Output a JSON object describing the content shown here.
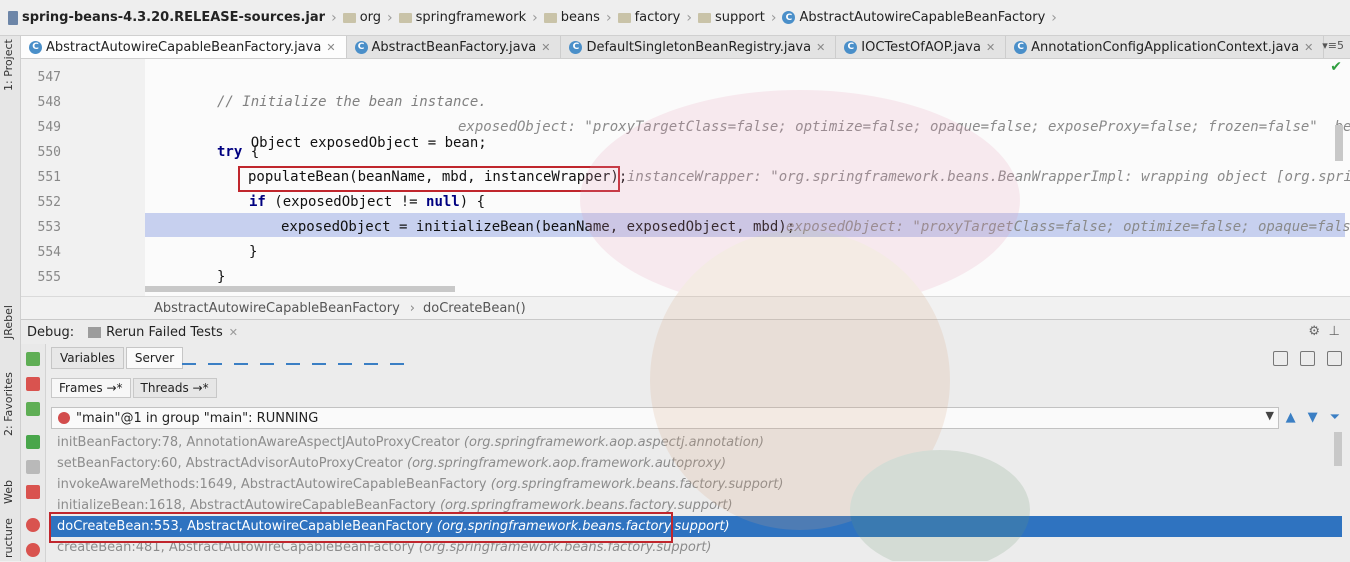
{
  "breadcrumb": [
    {
      "label": "spring-beans-4.3.20.RELEASE-sources.jar",
      "icon": "jar-icon"
    },
    {
      "label": "org",
      "icon": "folder-icon"
    },
    {
      "label": "springframework",
      "icon": "folder-icon"
    },
    {
      "label": "beans",
      "icon": "folder-icon"
    },
    {
      "label": "factory",
      "icon": "folder-icon"
    },
    {
      "label": "support",
      "icon": "folder-icon"
    },
    {
      "label": "AbstractAutowireCapableBeanFactory",
      "icon": "class-icon"
    }
  ],
  "side_tabs": {
    "project": "1: Project",
    "jrebel": "JRebel",
    "favorites": "2: Favorites",
    "web": "Web",
    "structure": "ructure"
  },
  "editor_tabs": [
    {
      "label": "AbstractAutowireCapableBeanFactory.java",
      "active": true
    },
    {
      "label": "AbstractBeanFactory.java",
      "active": false
    },
    {
      "label": "DefaultSingletonBeanRegistry.java",
      "active": false
    },
    {
      "label": "IOCTestOfAOP.java",
      "active": false
    },
    {
      "label": "AnnotationConfigApplicationContext.java",
      "active": false
    }
  ],
  "tab_menu": "5",
  "code": {
    "lines": [
      "547",
      "548",
      "549",
      "550",
      "551",
      "552",
      "553",
      "554",
      "555"
    ],
    "l548": "// Initialize the bean instance.",
    "l549_code": "Object exposedObject = bean;",
    "l549_hint": "exposedObject: \"proxyTargetClass=false; optimize=false; opaque=false; exposeProxy=false; frozen=false\"  bean: \"",
    "l550_kw": "try",
    "l550_rest": " {",
    "l551_code": "populateBean(beanName, mbd, instanceWrapper);",
    "l551_hint": "instanceWrapper: \"org.springframework.beans.BeanWrapperImpl: wrapping object [org.springfra",
    "l552_kw": "if",
    "l552_mid": " (exposedObject != ",
    "l552_kw2": "null",
    "l552_end": ") {",
    "l553_code": "exposedObject = initializeBean(beanName, exposedObject, mbd);",
    "l553_hint": "exposedObject: \"proxyTargetClass=false; optimize=false; opaque=false;",
    "l554": "}",
    "l555": "}"
  },
  "code_crumb": {
    "class": "AbstractAutowireCapableBeanFactory",
    "method": "doCreateBean()"
  },
  "debug": {
    "title": "Debug:",
    "rerun_tab": "Rerun Failed Tests",
    "tabs": [
      {
        "label": "Variables",
        "active": false
      },
      {
        "label": "Server",
        "active": true
      }
    ],
    "frame_tabs": [
      {
        "label": "Frames →*",
        "active": true
      },
      {
        "label": "Threads →*",
        "active": false
      }
    ],
    "thread": "\"main\"@1 in group \"main\": RUNNING",
    "frames": [
      {
        "method": "initBeanFactory:78, AnnotationAwareAspectJAutoProxyCreator",
        "pkg": "(org.springframework.aop.aspectj.annotation)"
      },
      {
        "method": "setBeanFactory:60, AbstractAdvisorAutoProxyCreator",
        "pkg": "(org.springframework.aop.framework.autoproxy)"
      },
      {
        "method": "invokeAwareMethods:1649, AbstractAutowireCapableBeanFactory",
        "pkg": "(org.springframework.beans.factory.support)"
      },
      {
        "method": "initializeBean:1618, AbstractAutowireCapableBeanFactory",
        "pkg": "(org.springframework.beans.factory.support)"
      },
      {
        "method": "doCreateBean:553, AbstractAutowireCapableBeanFactory",
        "pkg": "(org.springframework.beans.factory.support)",
        "selected": true
      },
      {
        "method": "createBean:481, AbstractAutowireCapableBeanFactory",
        "pkg": "(org.springframework.beans.factory.support)"
      }
    ]
  },
  "colors": {
    "selection": "#2f73c0",
    "annotation_box": "#c0262d",
    "execution_line": "#c7d0ef"
  }
}
